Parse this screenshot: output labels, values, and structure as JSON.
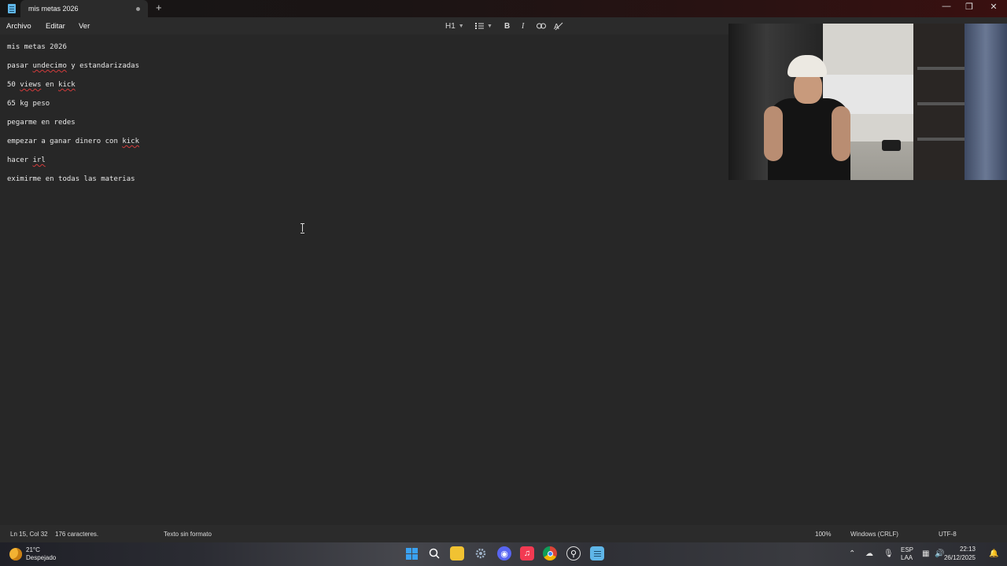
{
  "window": {
    "tab_title": "mis metas 2026",
    "new_tab": "+",
    "minimize": "—",
    "maximize": "❐",
    "close": "✕"
  },
  "menu": {
    "items": [
      "Archivo",
      "Editar",
      "Ver"
    ]
  },
  "toolbar": {
    "heading": "H1",
    "list_icon": "list-icon",
    "bold": "B",
    "italic": "I",
    "link_icon": "link-icon",
    "clear_format_icon": "clear-format-icon"
  },
  "document": {
    "lines": [
      {
        "text": "mis metas 2026"
      },
      {
        "pre": "pasar ",
        "mis": "undecimo",
        "post": " y estandarizadas"
      },
      {
        "pre": "50 ",
        "mis": "views",
        "post": " en ",
        "mis2": "kick"
      },
      {
        "text": "65 kg peso"
      },
      {
        "text": "pegarme en redes"
      },
      {
        "pre": "empezar a ganar dinero con ",
        "mis": "kick",
        "post": ""
      },
      {
        "pre": "hacer ",
        "mis": "irl",
        "post": ""
      },
      {
        "text": "eximirme en todas las materias"
      }
    ]
  },
  "status": {
    "position": "Ln 15, Col 32",
    "chars": "176 caracteres.",
    "format": "Texto sin formato",
    "zoom": "100%",
    "line_ending": "Windows (CRLF)",
    "encoding": "UTF-8"
  },
  "taskbar": {
    "temperature": "21°C",
    "weather": "Despejado",
    "lang": "ESP",
    "layout": "LAA",
    "time": "22:13",
    "date": "26/12/2025",
    "apps": [
      "start-icon",
      "search-icon",
      "file-explorer-icon",
      "settings-icon",
      "discord-icon",
      "music-icon",
      "chrome-icon",
      "steam-icon",
      "notepad-icon"
    ]
  },
  "colors": {
    "editor_bg": "#272727",
    "spell_error": "#d23b3b",
    "accent": "#3aa2f3"
  }
}
